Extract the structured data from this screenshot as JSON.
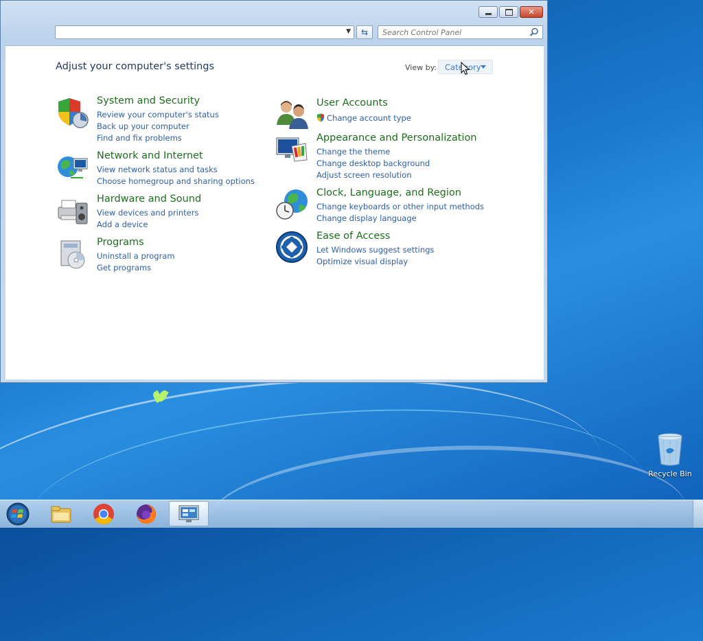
{
  "window": {
    "address_value": "",
    "search_placeholder": "Search Control Panel"
  },
  "content": {
    "heading": "Adjust your computer's settings",
    "view_by_label": "View by:",
    "view_by_value": "Category"
  },
  "categories_left": [
    {
      "title": "System and Security",
      "icon": "shield-icon",
      "links": [
        "Review your computer's status",
        "Back up your computer",
        "Find and fix problems"
      ]
    },
    {
      "title": "Network and Internet",
      "icon": "network-globe-icon",
      "links": [
        "View network status and tasks",
        "Choose homegroup and sharing options"
      ]
    },
    {
      "title": "Hardware and Sound",
      "icon": "printer-speaker-icon",
      "links": [
        "View devices and printers",
        "Add a device"
      ]
    },
    {
      "title": "Programs",
      "icon": "programs-disc-icon",
      "links": [
        "Uninstall a program",
        "Get programs"
      ]
    }
  ],
  "categories_right": [
    {
      "title": "User Accounts",
      "icon": "users-icon",
      "links": [
        "Change account type"
      ]
    },
    {
      "title": "Appearance and Personalization",
      "icon": "monitor-palette-icon",
      "links": [
        "Change the theme",
        "Change desktop background",
        "Adjust screen resolution"
      ]
    },
    {
      "title": "Clock, Language, and Region",
      "icon": "clock-globe-icon",
      "links": [
        "Change keyboards or other input methods",
        "Change display language"
      ]
    },
    {
      "title": "Ease of Access",
      "icon": "ease-of-access-icon",
      "links": [
        "Let Windows suggest settings",
        "Optimize visual display"
      ]
    }
  ],
  "desktop": {
    "recycle_bin_label": "Recycle Bin"
  },
  "taskbar": {
    "items": [
      "start-orb-icon",
      "file-explorer-icon",
      "chrome-icon",
      "firefox-icon",
      "control-panel-icon"
    ]
  },
  "colors": {
    "category_title": "#1c6e1c",
    "link": "#2e5fa8",
    "heading": "#1e395b"
  }
}
